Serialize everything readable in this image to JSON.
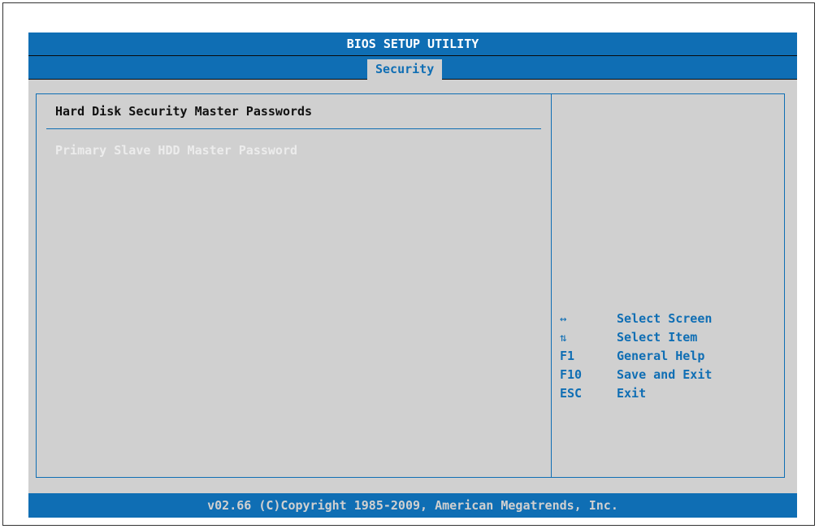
{
  "title": "BIOS SETUP UTILITY",
  "tabs": [
    {
      "label": "Security",
      "active": true
    }
  ],
  "section": {
    "title": "Hard Disk Security Master Passwords",
    "items": [
      {
        "label": "Primary Slave HDD Master Password"
      }
    ]
  },
  "help": [
    {
      "key_icon": "left-right-arrow-icon",
      "key_glyph": "↔",
      "desc": "Select Screen"
    },
    {
      "key_icon": "up-down-arrow-icon",
      "key_glyph": "⇅",
      "desc": "Select Item"
    },
    {
      "key": "F1",
      "desc": "General Help"
    },
    {
      "key": "F10",
      "desc": "Save and Exit"
    },
    {
      "key": "ESC",
      "desc": "Exit"
    }
  ],
  "footer": "v02.66 (C)Copyright 1985-2009, American Megatrends, Inc.",
  "colors": {
    "accent_blue": "#0f6eb4",
    "panel_gray": "#d0d0d0",
    "item_text": "#ececec",
    "heading_text": "#111111"
  }
}
